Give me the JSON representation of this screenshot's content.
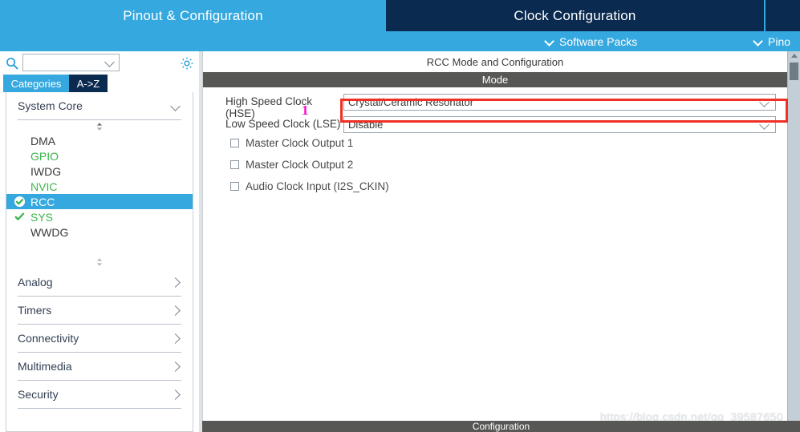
{
  "window": {
    "tabs": [
      {
        "label": "Pinout & Configuration",
        "state": "active"
      },
      {
        "label": "Clock Configuration",
        "state": "inactive"
      },
      {
        "label": "",
        "state": "inactive"
      }
    ],
    "menus": [
      {
        "label": "Software Packs",
        "icon": "chevron-down-icon"
      },
      {
        "label": "Pino",
        "icon": "chevron-down-icon"
      }
    ]
  },
  "sidebar": {
    "search": {
      "value": "",
      "placeholder": "",
      "icon": "search-icon"
    },
    "settings_icon": "gear-icon",
    "view_tabs": [
      {
        "label": "Categories",
        "selected": true
      },
      {
        "label": "A->Z",
        "selected": false
      }
    ],
    "groups": [
      {
        "label": "System Core",
        "expanded": true,
        "chevron": "chevron-down-icon",
        "items": [
          {
            "label": "DMA",
            "style": "plain",
            "checked": false
          },
          {
            "label": "GPIO",
            "style": "green",
            "checked": false
          },
          {
            "label": "IWDG",
            "style": "plain",
            "checked": false
          },
          {
            "label": "NVIC",
            "style": "green",
            "checked": false
          },
          {
            "label": "RCC",
            "style": "selected",
            "checked": true
          },
          {
            "label": "SYS",
            "style": "green",
            "checked": true
          },
          {
            "label": "WWDG",
            "style": "plain",
            "checked": false
          }
        ]
      },
      {
        "label": "Analog",
        "expanded": false,
        "chevron": "chevron-right-icon",
        "items": []
      },
      {
        "label": "Timers",
        "expanded": false,
        "chevron": "chevron-right-icon",
        "items": []
      },
      {
        "label": "Connectivity",
        "expanded": false,
        "chevron": "chevron-right-icon",
        "items": []
      },
      {
        "label": "Multimedia",
        "expanded": false,
        "chevron": "chevron-right-icon",
        "items": []
      },
      {
        "label": "Security",
        "expanded": false,
        "chevron": "chevron-right-icon",
        "items": []
      }
    ]
  },
  "main": {
    "title": "RCC Mode and Configuration",
    "mode_header": "Mode",
    "fields": [
      {
        "label": "High Speed Clock (HSE)",
        "value": "Crystal/Ceramic Resonator",
        "icon": "chevron-down-icon"
      },
      {
        "label": "Low Speed Clock (LSE)",
        "value": "Disable",
        "icon": "chevron-down-icon"
      }
    ],
    "checkboxes": [
      {
        "label": "Master Clock Output 1",
        "checked": false
      },
      {
        "label": "Master Clock Output 2",
        "checked": false
      },
      {
        "label": "Audio Clock Input (I2S_CKIN)",
        "checked": false
      }
    ],
    "config_header": "Configuration"
  },
  "annotations": {
    "marker_1": "1",
    "highlight_color": "#ee3124",
    "marker_color": "#ff00d0"
  },
  "watermark": {
    "text": "https://blog.csdn.net/qq_39587650"
  },
  "colors": {
    "accent_blue": "#35a8df",
    "dark_navy": "#0b2a4f",
    "bar_gray": "#575756",
    "green": "#3bb54a"
  }
}
